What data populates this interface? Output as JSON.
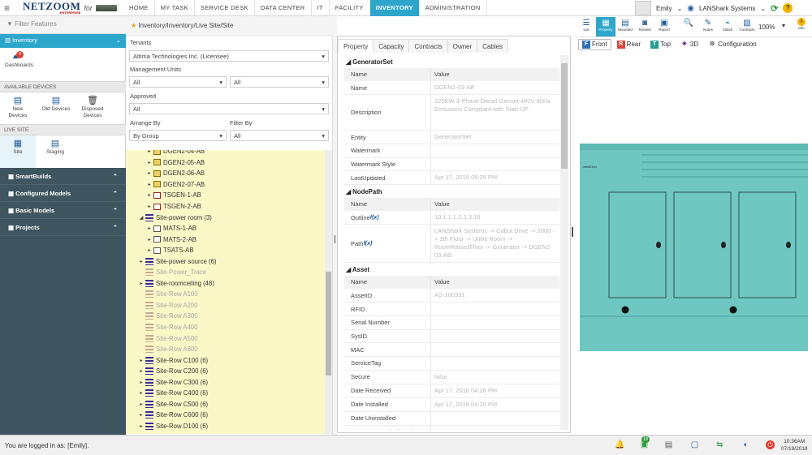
{
  "app": {
    "logo": "NETZOOM",
    "logo_sub": "ENTERPRISE",
    "logo_for": "for",
    "menu_icon": "hamburger-icon"
  },
  "nav": {
    "tabs": [
      "HOME",
      "MY TASK",
      "SERVICE DESK",
      "DATA CENTER",
      "IT",
      "FACILITY",
      "INVENTORY",
      "ADMINISTRATION"
    ],
    "active": "INVENTORY"
  },
  "user": {
    "name": "Emily",
    "org": "LANShark Systems"
  },
  "sidebar": {
    "filter_placeholder": "Filter Features",
    "module": "Inventory",
    "dashboards_label": "Dashboards",
    "dashboards_badge": "9",
    "available_devices": "AVAILABLE DEVICES",
    "new_devices": "New Devices",
    "old_devices": "Old Devices",
    "disposed_devices": "Disposed Devices",
    "live_site": "LIVE SITE",
    "site": "Site",
    "staging": "Staging",
    "menu": [
      "SmartBuilds",
      "Configured Models",
      "Basic Models",
      "Projects"
    ]
  },
  "mid": {
    "breadcrumb": "Inventory/Inventory/Live Site/Site",
    "tenants_label": "Tenants",
    "tenants_value": "Altima Technologies Inc. (Licensee)",
    "mgmt_label": "Management Units",
    "mgmt_a": "All",
    "mgmt_b": "All",
    "approved_label": "Approved",
    "approved_value": "All",
    "arrange_label": "Arrange By",
    "arrange_value": "By Group",
    "filter_label": "Filter By",
    "filter_value": "All",
    "tree": [
      {
        "label": "DGEN2-04-AB",
        "indent": 2,
        "icon": "gen",
        "arrow": "▸"
      },
      {
        "label": "DGEN2-05-AB",
        "indent": 2,
        "icon": "gen",
        "arrow": "▸"
      },
      {
        "label": "DGEN2-06-AB",
        "indent": 2,
        "icon": "gen",
        "arrow": "▸"
      },
      {
        "label": "DGEN2-07-AB",
        "indent": 2,
        "icon": "gen",
        "arrow": "▸"
      },
      {
        "label": "TSGEN-1-AB",
        "indent": 2,
        "icon": "ts",
        "arrow": "▸"
      },
      {
        "label": "TSGEN-2-AB",
        "indent": 2,
        "icon": "ts",
        "arrow": "▸"
      },
      {
        "label": "Site-power room (3)",
        "indent": 1,
        "icon": "site",
        "arrow": "◢"
      },
      {
        "label": "MATS-1-AB",
        "indent": 2,
        "icon": "mat",
        "arrow": "▸"
      },
      {
        "label": "MATS-2-AB",
        "indent": 2,
        "icon": "mat",
        "arrow": "▸"
      },
      {
        "label": "TSATS-AB",
        "indent": 2,
        "icon": "mat",
        "arrow": "▸"
      },
      {
        "label": "Site-power source (6)",
        "indent": 1,
        "icon": "site",
        "arrow": "▸"
      },
      {
        "label": "Site-Power_Trace",
        "indent": 1,
        "icon": "site gray",
        "arrow": "",
        "gray": true
      },
      {
        "label": "Site-roomceiling (48)",
        "indent": 1,
        "icon": "site",
        "arrow": "▸"
      },
      {
        "label": "Site-Row A100",
        "indent": 1,
        "icon": "site gray",
        "arrow": "",
        "gray": true
      },
      {
        "label": "Site-Row A200",
        "indent": 1,
        "icon": "site gray",
        "arrow": "",
        "gray": true
      },
      {
        "label": "Site-Row A300",
        "indent": 1,
        "icon": "site gray",
        "arrow": "",
        "gray": true
      },
      {
        "label": "Site-Row A400",
        "indent": 1,
        "icon": "site gray",
        "arrow": "",
        "gray": true
      },
      {
        "label": "Site-Row A500",
        "indent": 1,
        "icon": "site gray",
        "arrow": "",
        "gray": true
      },
      {
        "label": "Site-Row A600",
        "indent": 1,
        "icon": "site gray",
        "arrow": "",
        "gray": true
      },
      {
        "label": "Site-Row C100 (6)",
        "indent": 1,
        "icon": "site",
        "arrow": "▸"
      },
      {
        "label": "Site-Row C200 (6)",
        "indent": 1,
        "icon": "site",
        "arrow": "▸"
      },
      {
        "label": "Site-Row C300 (6)",
        "indent": 1,
        "icon": "site",
        "arrow": "▸"
      },
      {
        "label": "Site-Row C400 (6)",
        "indent": 1,
        "icon": "site",
        "arrow": "▸"
      },
      {
        "label": "Site-Row C500 (6)",
        "indent": 1,
        "icon": "site",
        "arrow": "▸"
      },
      {
        "label": "Site-Row C600 (6)",
        "indent": 1,
        "icon": "site",
        "arrow": "▸"
      },
      {
        "label": "Site-Row D100 (6)",
        "indent": 1,
        "icon": "site",
        "arrow": "▸"
      }
    ]
  },
  "prop": {
    "tabs": [
      "Property",
      "Capacity",
      "Contracts",
      "Owner",
      "Cables"
    ],
    "active": "Property",
    "col_name": "Name",
    "col_value": "Value",
    "sections": [
      {
        "title": "GeneratorSet",
        "rows": [
          {
            "k": "Name",
            "v": "DGEN2-03-AB"
          },
          {
            "k": "Description",
            "v": "125KW 3-Phase Diesel Genset 480V 60Hz Emissions Compliant with Start UP"
          },
          {
            "k": "Entity",
            "v": "GeneratorSet"
          },
          {
            "k": "Watermark",
            "v": ""
          },
          {
            "k": "Watermark Style",
            "v": ""
          },
          {
            "k": "LastUpdated",
            "v": "Apr 17, 2018 05:26 PM"
          }
        ]
      },
      {
        "title": "NodePath",
        "rows": [
          {
            "k": "Outline",
            "v": "10.1.1.1.2.2.3.16",
            "fx": true
          },
          {
            "k": "Path",
            "v": "LANShark Systems -> Cabot Drive -> 2000 -> 3th Floor -> Utility Room -> RoomRaisedFloor -> Generator -> DGEN2-03-AB",
            "fx": true
          }
        ]
      },
      {
        "title": "Asset",
        "rows": [
          {
            "k": "AssetID",
            "v": "AS-100331"
          },
          {
            "k": "RFID",
            "v": ""
          },
          {
            "k": "Serial Number",
            "v": ""
          },
          {
            "k": "SysID",
            "v": ""
          },
          {
            "k": "MAC",
            "v": ""
          },
          {
            "k": "ServiceTag",
            "v": ""
          },
          {
            "k": "Secure",
            "v": "false"
          },
          {
            "k": "Date Received",
            "v": "Apr 17, 2018 04:26 PM"
          },
          {
            "k": "Date Installed",
            "v": "Apr 17, 2018 04:26 PM"
          },
          {
            "k": "Date Uninstalled",
            "v": ""
          },
          {
            "k": "Date Decommissioned",
            "v": ""
          }
        ]
      }
    ]
  },
  "right": {
    "toolbar": [
      {
        "label": "List",
        "icon": "list-icon",
        "g": "☰"
      },
      {
        "label": "Property",
        "icon": "property-icon",
        "g": "▦",
        "active": true
      },
      {
        "label": "Mounted",
        "icon": "mounted-icon",
        "g": "▤"
      },
      {
        "label": "Tenants",
        "icon": "tenants-icon",
        "g": "◙"
      },
      {
        "label": "Report",
        "icon": "report-icon",
        "g": "▣"
      },
      {
        "label": "",
        "icon": "search-icon",
        "g": "🔍"
      },
      {
        "label": "Notes",
        "icon": "notes-icon",
        "g": "✎"
      },
      {
        "label": "Attach",
        "icon": "attach-icon",
        "g": "⌁"
      },
      {
        "label": "Contracts",
        "icon": "contracts-icon",
        "g": "▧"
      }
    ],
    "zoom": "100%",
    "info_label": "Info",
    "view_tabs": [
      {
        "label": "Front",
        "badge": "F",
        "color": "#2f6fb8",
        "active": true
      },
      {
        "label": "Rear",
        "badge": "R",
        "color": "#d9433a"
      },
      {
        "label": "Top",
        "badge": "T",
        "color": "#2a9d8f"
      },
      {
        "label": "3D",
        "badge": "❖",
        "color": "#7b3fa0"
      },
      {
        "label": "Configuration",
        "badge": "⚙",
        "color": "#555"
      }
    ],
    "genset_brand": "intelliGen"
  },
  "status": {
    "logged_in": "You are logged in as: [Emily].",
    "badge": "18",
    "time": "10:36AM",
    "date": "07/19/2018"
  },
  "colors": {
    "accent": "#2da6cc",
    "sidebar_dark": "#3f5560",
    "tree_bg": "#fbf8c8",
    "genset": "#6fc7c2"
  }
}
